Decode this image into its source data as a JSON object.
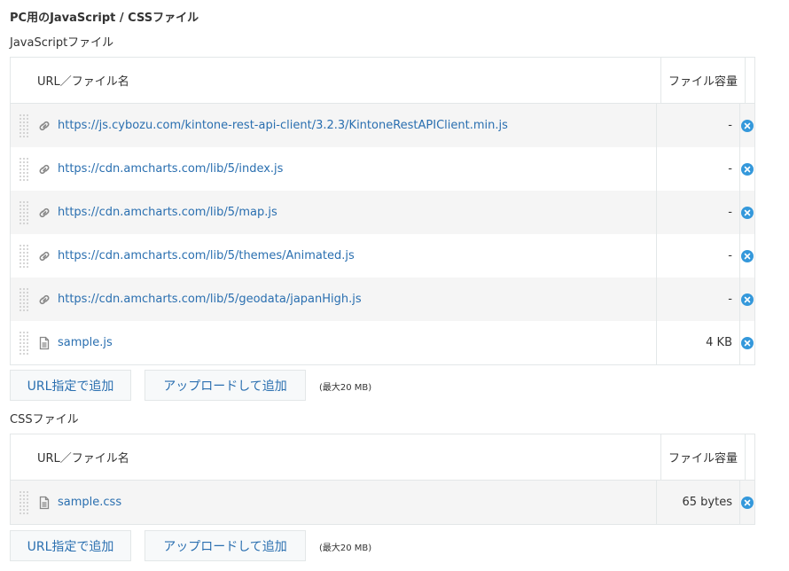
{
  "page_title": "PC用のJavaScript / CSSファイル",
  "js_section": {
    "label": "JavaScriptファイル",
    "header": {
      "name": "URL／ファイル名",
      "size": "ファイル容量"
    },
    "rows": [
      {
        "type": "url",
        "name": "https://js.cybozu.com/kintone-rest-api-client/3.2.3/KintoneRestAPIClient.min.js",
        "size": "-"
      },
      {
        "type": "url",
        "name": "https://cdn.amcharts.com/lib/5/index.js",
        "size": "-"
      },
      {
        "type": "url",
        "name": "https://cdn.amcharts.com/lib/5/map.js",
        "size": "-"
      },
      {
        "type": "url",
        "name": "https://cdn.amcharts.com/lib/5/themes/Animated.js",
        "size": "-"
      },
      {
        "type": "url",
        "name": "https://cdn.amcharts.com/lib/5/geodata/japanHigh.js",
        "size": "-"
      },
      {
        "type": "file",
        "name": "sample.js",
        "size": "4 KB"
      }
    ],
    "add_url_label": "URL指定で追加",
    "upload_label": "アップロードして追加",
    "max_note": "(最大20 MB)"
  },
  "css_section": {
    "label": "CSSファイル",
    "header": {
      "name": "URL／ファイル名",
      "size": "ファイル容量"
    },
    "rows": [
      {
        "type": "file",
        "name": "sample.css",
        "size": "65 bytes"
      }
    ],
    "add_url_label": "URL指定で追加",
    "upload_label": "アップロードして追加",
    "max_note": "(最大20 MB)"
  },
  "icons": {
    "drag": "drag-handle-icon",
    "url": "link-icon",
    "file": "file-icon",
    "delete": "delete-icon"
  },
  "colors": {
    "link": "#2a6fb0",
    "delete": "#3498db",
    "border": "#e3e7e8",
    "row_alt": "#f5f5f5"
  }
}
